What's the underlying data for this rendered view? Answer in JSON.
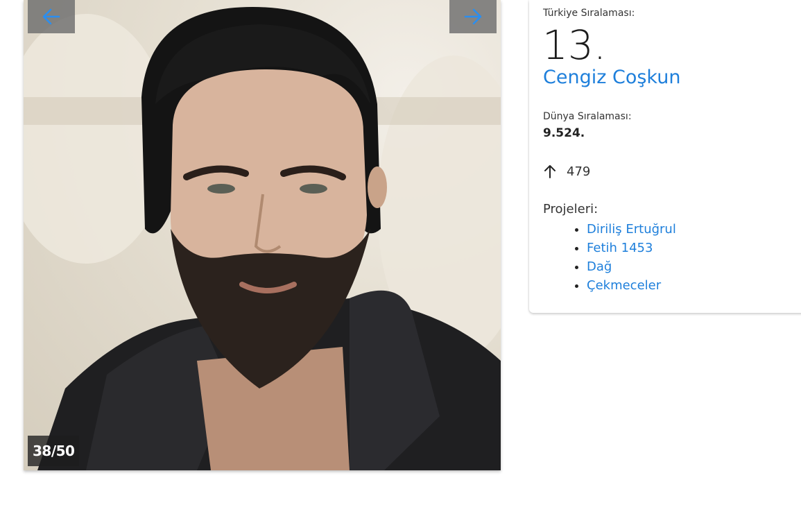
{
  "gallery": {
    "counter": "38/50",
    "prev_icon": "arrow-left-icon",
    "next_icon": "arrow-right-icon"
  },
  "info": {
    "turkey_rank_label": "Türkiye Sıralaması:",
    "turkey_rank": "13.",
    "name": "Cengiz Coşkun",
    "world_rank_label": "Dünya Sıralaması:",
    "world_rank": "9.524.",
    "change_icon": "arrow-up-icon",
    "change_value": "479",
    "projects_label": "Projeleri:",
    "projects": [
      "Diriliş Ertuğrul",
      "Fetih 1453",
      "Dağ",
      "Çekmeceler"
    ]
  },
  "colors": {
    "accent": "#1e7fdb",
    "nav_button_bg": "#6e6e6e"
  }
}
